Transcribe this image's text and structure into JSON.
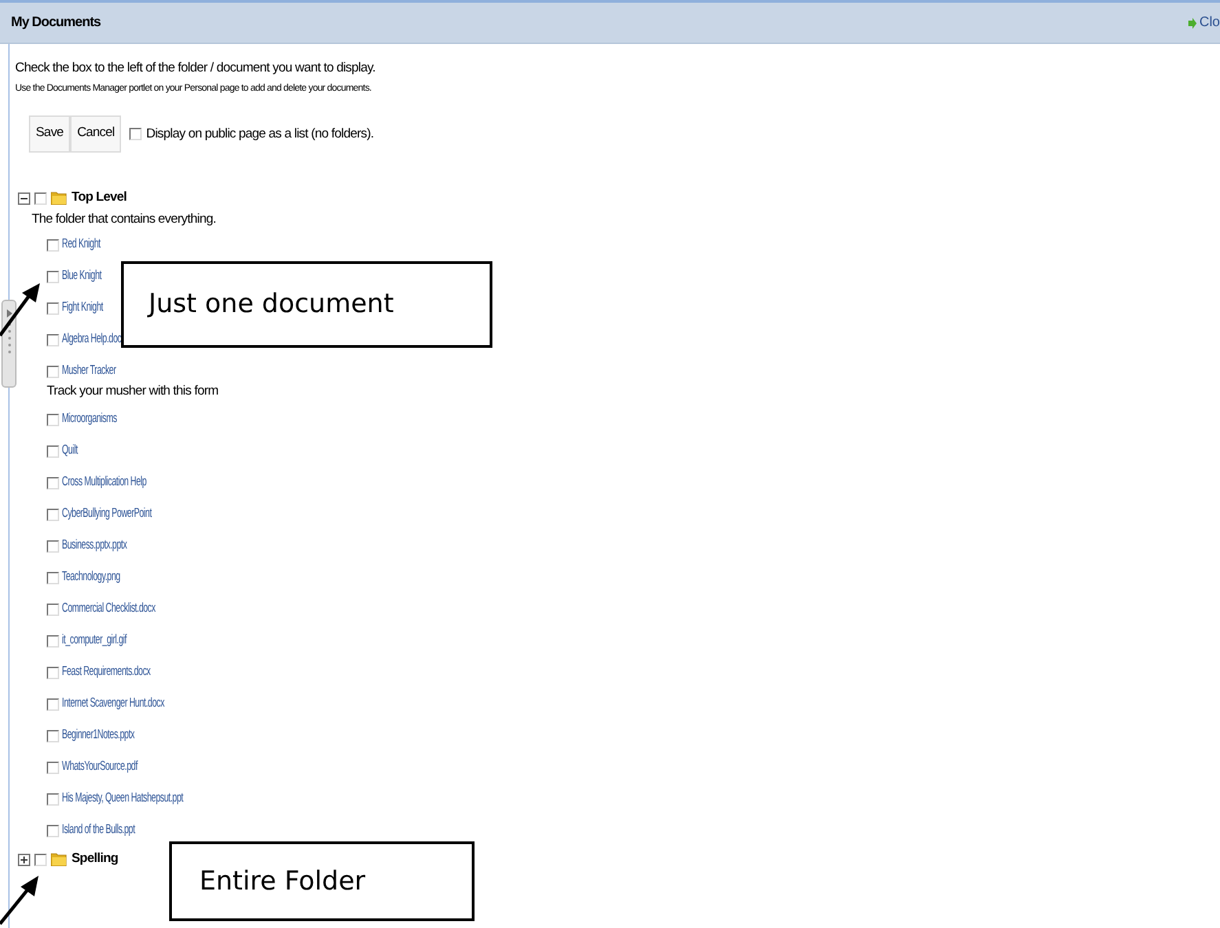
{
  "header": {
    "title": "My Documents",
    "close_link": "Clo"
  },
  "instructions": [
    "Check the box to the left of the folder / document you want to display.",
    "Use the Documents Manager portlet on your Personal page to add and delete your documents."
  ],
  "buttons": [
    "Save",
    "Cancel"
  ],
  "list_option": {
    "label": "Display on public page as a list (no folders).",
    "checked": false
  },
  "tree": [
    {
      "name": "Top Level",
      "expanded": true,
      "checked": false,
      "description": "The folder that contains everything.",
      "children": [
        {
          "name": "Red Knight",
          "checked": false
        },
        {
          "name": "Blue Knight",
          "checked": false
        },
        {
          "name": "Fight Knight",
          "checked": false
        },
        {
          "name": "Algebra Help.doc",
          "checked": false
        },
        {
          "name": "Musher Tracker",
          "checked": false,
          "description": "Track your musher with this form"
        },
        {
          "name": "Microorganisms",
          "checked": false
        },
        {
          "name": "Quilt",
          "checked": false
        },
        {
          "name": "Cross Multiplication Help",
          "checked": false
        },
        {
          "name": "CyberBullying PowerPoint",
          "checked": false
        },
        {
          "name": "Business.pptx.pptx",
          "checked": false
        },
        {
          "name": "Teachnology.png",
          "checked": false
        },
        {
          "name": "Commercial Checklist.docx",
          "checked": false
        },
        {
          "name": "it_computer_girl.gif",
          "checked": false
        },
        {
          "name": "Feast Requirements.docx",
          "checked": false
        },
        {
          "name": "Internet Scavenger Hunt.docx",
          "checked": false
        },
        {
          "name": "Beginner1Notes.pptx",
          "checked": false
        },
        {
          "name": "WhatsYourSource.pdf",
          "checked": false
        },
        {
          "name": "His Majesty, Queen Hatshepsut.ppt",
          "checked": false
        },
        {
          "name": "Island of the Bulls.ppt",
          "checked": false
        }
      ]
    },
    {
      "name": "Spelling",
      "expanded": false,
      "checked": false
    }
  ],
  "annotations": [
    {
      "text": "Just one document"
    },
    {
      "text": "Entire Folder"
    }
  ]
}
